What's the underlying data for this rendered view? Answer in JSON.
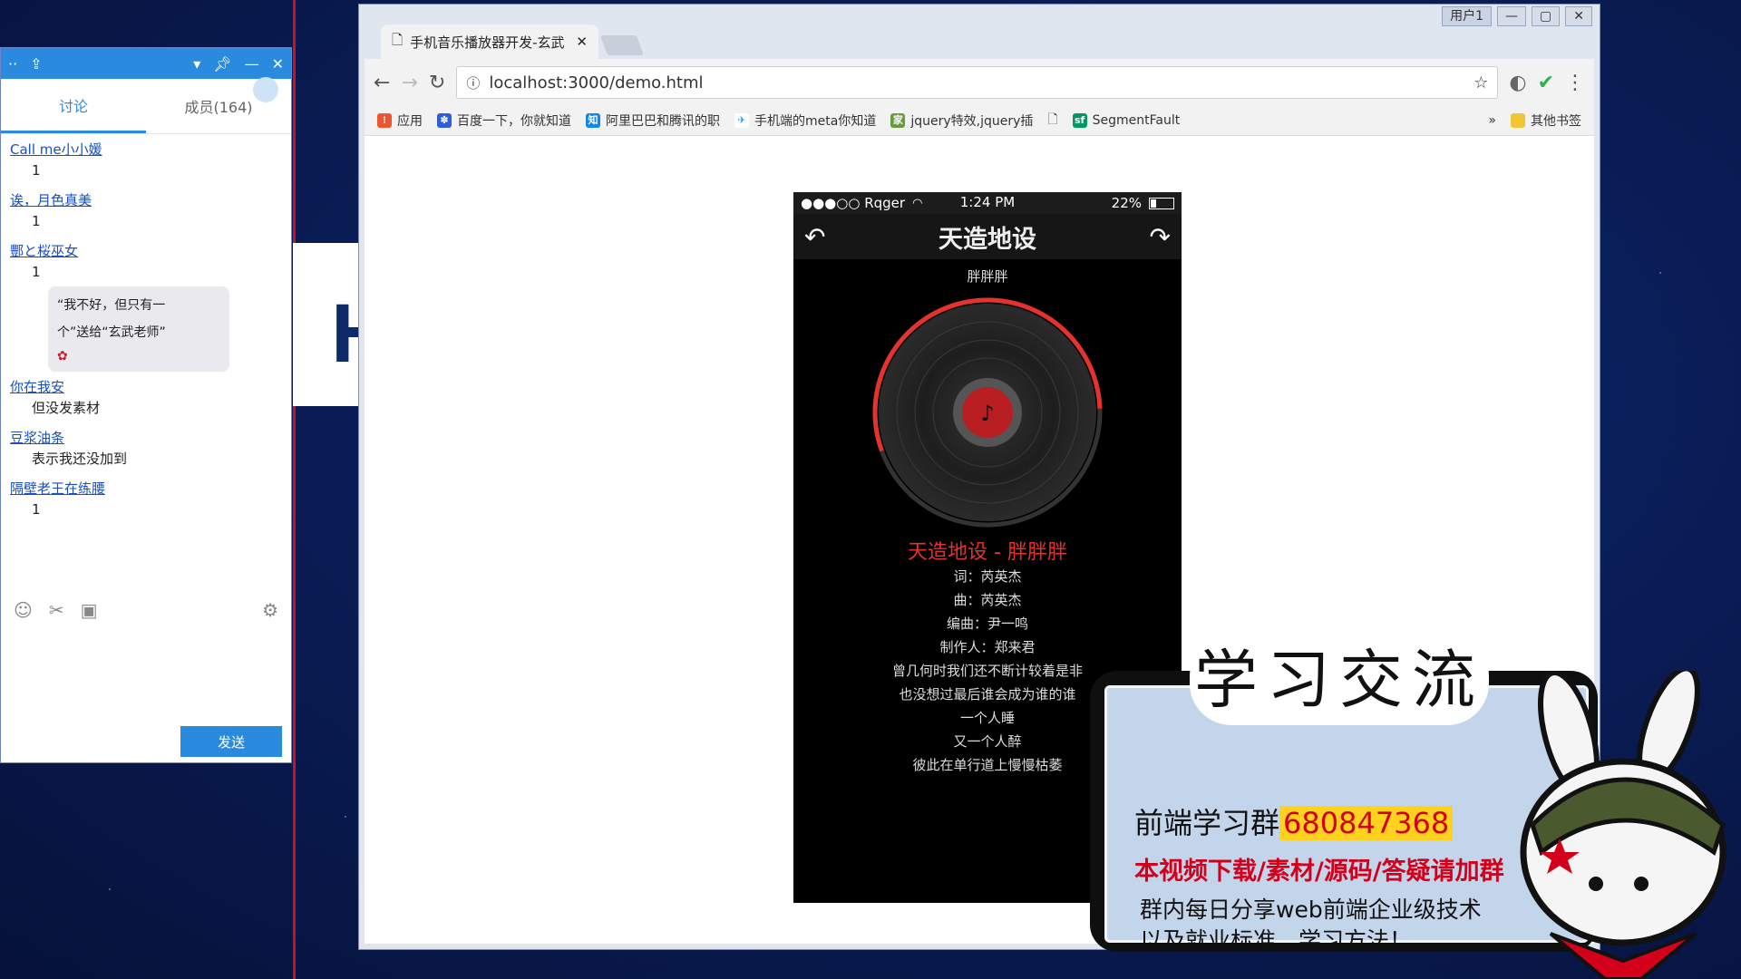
{
  "chat": {
    "tabs": [
      "讨论",
      "成员(164)"
    ],
    "messages": [
      {
        "name": "Call me小小媛",
        "text": "1"
      },
      {
        "name": "诶，月色真美",
        "text": "1"
      },
      {
        "name": "酆と桜巫女",
        "text": "1"
      }
    ],
    "gift_bubble": [
      "“我不好，但只有一",
      "个”送给“玄武老师”"
    ],
    "messages2": [
      {
        "name": "你在我安",
        "text": "但没发素材"
      },
      {
        "name": "豆浆油条",
        "text": "表示我还没加到"
      },
      {
        "name": "隔壁老王在练腰",
        "text": "1"
      }
    ],
    "send_label": "发送",
    "icons": [
      "smiley-icon",
      "scissors-icon",
      "image-icon",
      "gear-icon"
    ]
  },
  "browser": {
    "window_user": "用户1",
    "tab_title": "手机音乐播放器开发-玄武",
    "url": "localhost:3000/demo.html",
    "bookmarks": [
      "应用",
      "百度一下，你就知道",
      "阿里巴巴和腾讯的职",
      "手机端的meta你知道",
      "jquery特效,jquery插",
      "SegmentFault"
    ],
    "more_bookmarks": "»",
    "other_bookmarks": "其他书签"
  },
  "phone": {
    "carrier": "●●●○○ Rqger",
    "time": "1:24 PM",
    "battery": "22%",
    "battery_level": 0.22,
    "song_title": "天造地设",
    "singer": "胖胖胖",
    "progress": 0.55,
    "lyrics_title": "天造地设 - 胖胖胖",
    "lyrics": [
      "词：芮英杰",
      "曲：芮英杰",
      "编曲：尹一鸣",
      "制作人：郑来君",
      "曾几何时我们还不断计较着是非",
      "也没想过最后谁会成为谁的谁",
      "一个人睡",
      "又一个人醉",
      "彼此在单行道上慢慢枯萎"
    ],
    "accent_color": "#e5322d"
  },
  "promo": {
    "header": "学习交流",
    "group_label": "前端学习群",
    "group_number": "680847368",
    "line2": "本视频下载/素材/源码/答疑请加群",
    "line3a": "群内每日分享web前端企业级技术",
    "line3b": "以及就业标准，学习方法！"
  }
}
